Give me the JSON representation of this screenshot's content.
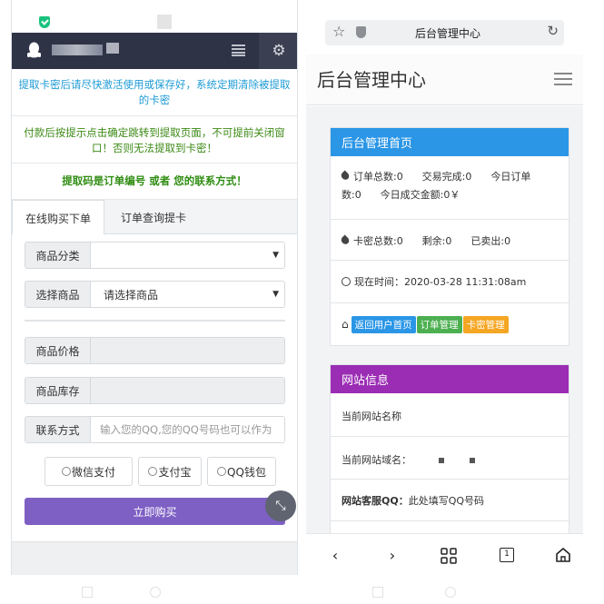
{
  "left": {
    "notices": {
      "blue": "提取卡密后请尽快激活使用或保存好，系统定期清除被提取的卡密",
      "green": "付款后按提示点击确定跳转到提取页面，不可提前关闭窗口！否则无法提取到卡密！",
      "green_bold": "提取码是订单编号 或者 您的联系方式！"
    },
    "tabs": [
      {
        "label": "在线购买下单"
      },
      {
        "label": "订单查询提卡"
      }
    ],
    "form": {
      "category_label": "商品分类",
      "category_value": "",
      "product_label": "选择商品",
      "product_value": "请选择商品",
      "price_label": "商品价格",
      "price_value": "",
      "stock_label": "商品库存",
      "stock_value": "",
      "contact_label": "联系方式",
      "contact_placeholder": "输入您的QQ,您的QQ号码也可以作为"
    },
    "payments": [
      {
        "label": "微信支付"
      },
      {
        "label": "支付宝"
      },
      {
        "label": "QQ钱包"
      }
    ],
    "buy_label": "立即购买"
  },
  "right": {
    "browser_title": "后台管理中心",
    "page_title": "后台管理中心",
    "panel1": {
      "title": "后台管理首页",
      "line1": "订单总数:0      交易完成:0      今日订单",
      "line1b": "数:0      今日成交金额:0￥",
      "line2": "卡密总数:0      剩余:0      已卖出:0",
      "time_prefix": "现在时间：",
      "time_value": "2020-03-28 11:31:08am",
      "btn_home": "返回用户首页",
      "btn_orders": "订单管理",
      "btn_cards": "卡密管理"
    },
    "panel2": {
      "title": "网站信息",
      "site_name": "当前网站名称",
      "site_domain": "当前网站域名：",
      "site_qq_label": "网站客服QQ：",
      "site_qq_value": "此处填写QQ号码"
    }
  }
}
